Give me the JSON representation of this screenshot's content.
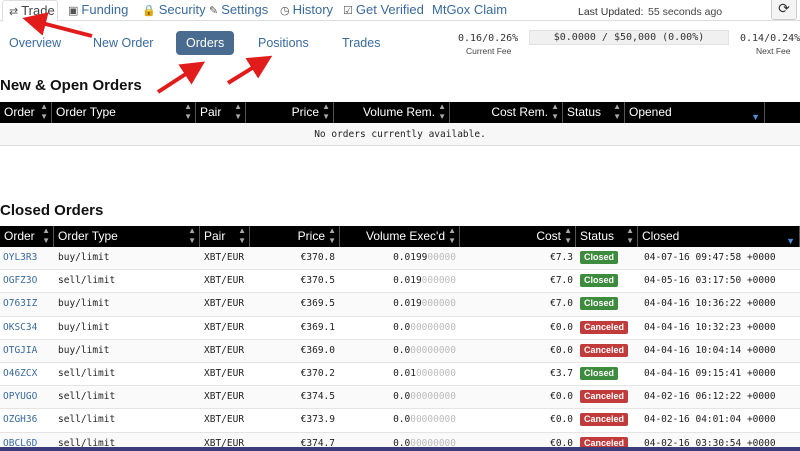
{
  "topnav": {
    "tabs": [
      {
        "id": "trade",
        "icon": "⇄",
        "label": "Trade",
        "active": true
      },
      {
        "id": "funding",
        "icon": "▣",
        "label": "Funding"
      },
      {
        "id": "security",
        "icon": "🔒",
        "label": "Security"
      },
      {
        "id": "settings",
        "icon": "✎",
        "label": "Settings"
      },
      {
        "id": "history",
        "icon": "◷",
        "label": "History"
      },
      {
        "id": "getverified",
        "icon": "☑",
        "label": "Get Verified"
      },
      {
        "id": "mtgoxclaim",
        "icon": "",
        "label": "MtGox Claim"
      }
    ],
    "last_updated_label": "Last Updated:",
    "last_updated_value": "55 seconds ago"
  },
  "subnav": {
    "tabs": [
      {
        "id": "overview",
        "label": "Overview"
      },
      {
        "id": "neworder",
        "label": "New Order"
      },
      {
        "id": "orders",
        "label": "Orders",
        "active": true
      },
      {
        "id": "positions",
        "label": "Positions"
      },
      {
        "id": "trades",
        "label": "Trades"
      }
    ]
  },
  "fees": {
    "current_fee": "0.16/0.26%",
    "current_fee_label": "Current Fee",
    "volume": "$0.0000 / $50,000 (0.00%)",
    "next_fee": "0.14/0.24%",
    "next_fee_label": "Next Fee"
  },
  "open_orders": {
    "title": "New & Open Orders",
    "columns": [
      "Order",
      "Order Type",
      "Pair",
      "Price",
      "Volume Rem.",
      "Cost Rem.",
      "Status",
      "Opened"
    ],
    "empty_message": "No orders currently available."
  },
  "closed_orders": {
    "title": "Closed Orders",
    "columns": [
      "Order",
      "Order Type",
      "Pair",
      "Price",
      "Volume Exec'd",
      "Cost",
      "Status",
      "Closed"
    ],
    "rows": [
      {
        "order": "OYL3R3",
        "type": "buy/limit",
        "pair": "XBT/EUR",
        "price": "€370.8",
        "vol": "0.0199",
        "vol_pad": "00000",
        "cost": "€7.3",
        "status": "Closed",
        "closed": "04-07-16 09:47:58 +0000"
      },
      {
        "order": "OGFZ3O",
        "type": "sell/limit",
        "pair": "XBT/EUR",
        "price": "€370.5",
        "vol": "0.019",
        "vol_pad": "000000",
        "cost": "€7.0",
        "status": "Closed",
        "closed": "04-05-16 03:17:50 +0000"
      },
      {
        "order": "O763IZ",
        "type": "buy/limit",
        "pair": "XBT/EUR",
        "price": "€369.5",
        "vol": "0.019",
        "vol_pad": "000000",
        "cost": "€7.0",
        "status": "Closed",
        "closed": "04-04-16 10:36:22 +0000"
      },
      {
        "order": "OKSC34",
        "type": "buy/limit",
        "pair": "XBT/EUR",
        "price": "€369.1",
        "vol": "0.0",
        "vol_pad": "00000000",
        "cost": "€0.0",
        "status": "Canceled",
        "closed": "04-04-16 10:32:23 +0000"
      },
      {
        "order": "OTGJIA",
        "type": "buy/limit",
        "pair": "XBT/EUR",
        "price": "€369.0",
        "vol": "0.0",
        "vol_pad": "00000000",
        "cost": "€0.0",
        "status": "Canceled",
        "closed": "04-04-16 10:04:14 +0000"
      },
      {
        "order": "O46ZCX",
        "type": "sell/limit",
        "pair": "XBT/EUR",
        "price": "€370.2",
        "vol": "0.01",
        "vol_pad": "0000000",
        "cost": "€3.7",
        "status": "Closed",
        "closed": "04-04-16 09:15:41 +0000"
      },
      {
        "order": "OPYUGO",
        "type": "sell/limit",
        "pair": "XBT/EUR",
        "price": "€374.5",
        "vol": "0.0",
        "vol_pad": "00000000",
        "cost": "€0.0",
        "status": "Canceled",
        "closed": "04-02-16 06:12:22 +0000"
      },
      {
        "order": "OZGH36",
        "type": "sell/limit",
        "pair": "XBT/EUR",
        "price": "€373.9",
        "vol": "0.0",
        "vol_pad": "00000000",
        "cost": "€0.0",
        "status": "Canceled",
        "closed": "04-02-16 04:01:04 +0000"
      },
      {
        "order": "OBCL6D",
        "type": "sell/limit",
        "pair": "XBT/EUR",
        "price": "€374.7",
        "vol": "0.0",
        "vol_pad": "00000000",
        "cost": "€0.0",
        "status": "Canceled",
        "closed": "04-02-16 03:30:54 +0000"
      }
    ]
  },
  "colors": {
    "accent": "#486b8f",
    "closed": "#3d8b3d",
    "canceled": "#c23b3b",
    "arrow": "#e21b1b"
  }
}
